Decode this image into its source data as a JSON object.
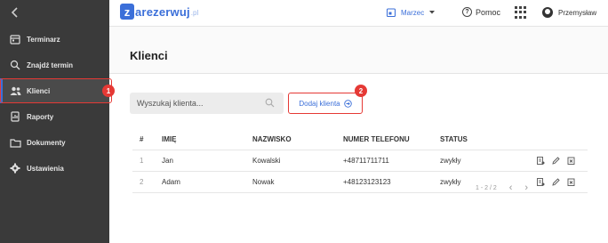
{
  "topbar": {
    "logo_letter": "z",
    "logo_brand": "arezerwuj",
    "logo_tld": ".pl",
    "month": "Marzec",
    "help": "Pomoc",
    "user": "Przemysław"
  },
  "sidebar": {
    "items": [
      {
        "label": "Terminarz",
        "icon": "calendar-icon"
      },
      {
        "label": "Znajdź termin",
        "icon": "search-icon"
      },
      {
        "label": "Klienci",
        "icon": "users-icon",
        "active": true
      },
      {
        "label": "Raporty",
        "icon": "report-icon"
      },
      {
        "label": "Dokumenty",
        "icon": "folder-icon"
      },
      {
        "label": "Ustawienia",
        "icon": "gear-icon"
      }
    ]
  },
  "main": {
    "title": "Klienci",
    "search_placeholder": "Wyszukaj klienta...",
    "add_button": "Dodaj klienta",
    "table": {
      "headers": [
        "#",
        "IMIĘ",
        "NAZWISKO",
        "NUMER TELEFONU",
        "STATUS"
      ],
      "rows": [
        [
          "1",
          "Jan",
          "Kowalski",
          "+48711711711",
          "zwykły"
        ],
        [
          "2",
          "Adam",
          "Nowak",
          "+48123123123",
          "zwykły"
        ]
      ]
    },
    "pagination": "1 - 2 / 2"
  },
  "callouts": [
    "1",
    "2"
  ],
  "colors": {
    "accent": "#3b6fd9",
    "sidebar": "#3a3a3a",
    "callout": "#e53935"
  }
}
